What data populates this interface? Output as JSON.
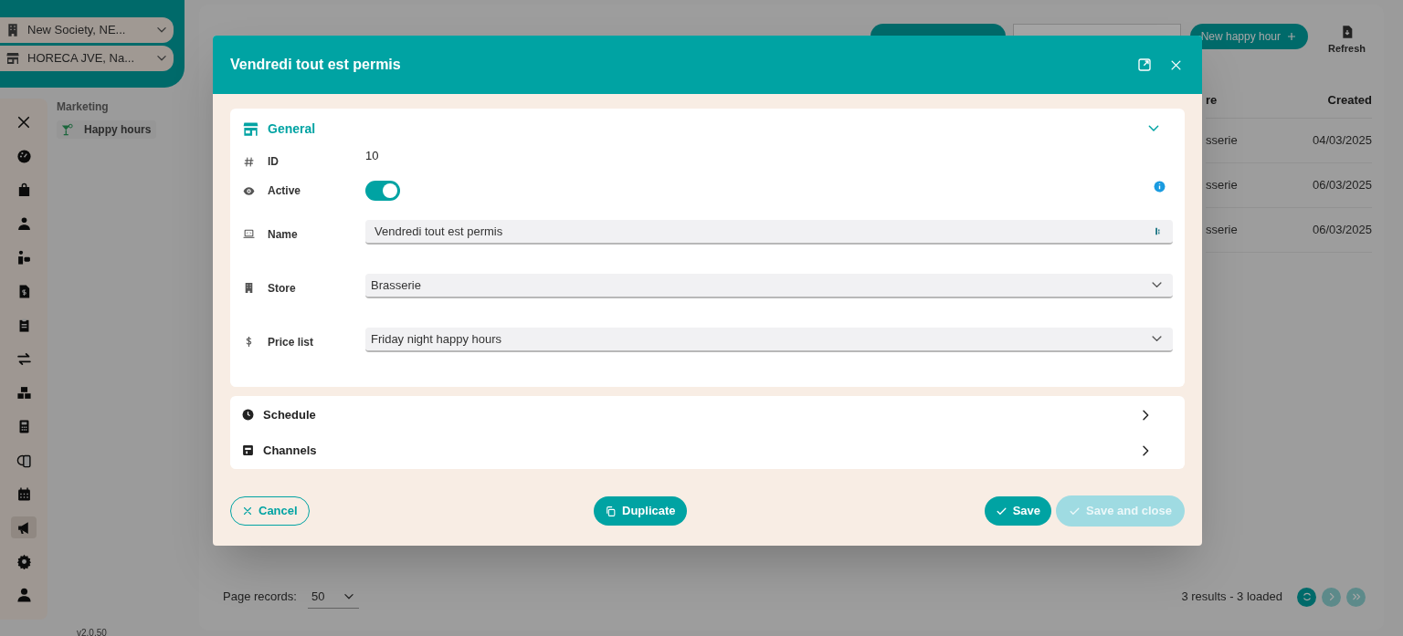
{
  "sidebar": {
    "selectors": [
      {
        "label": "New Society, NE..."
      },
      {
        "label": "HORECA JVE, Na..."
      }
    ],
    "rail": [
      {
        "selected": false
      },
      {
        "selected": false
      },
      {
        "selected": false
      },
      {
        "selected": false
      },
      {
        "selected": false
      },
      {
        "selected": false
      },
      {
        "selected": false
      },
      {
        "selected": false
      },
      {
        "selected": false
      },
      {
        "selected": false
      },
      {
        "selected": false
      },
      {
        "selected": true
      },
      {
        "selected": false
      },
      {
        "selected": false
      }
    ],
    "submenu": {
      "section": "Marketing",
      "items": [
        {
          "label": "Happy hours",
          "selected": true
        }
      ]
    },
    "version": "v2.0.50"
  },
  "toolbar": {
    "new_button": "New happy hour",
    "refresh": "Refresh"
  },
  "table": {
    "columns": [
      "re",
      "Created"
    ],
    "rows": [
      [
        "sserie",
        "04/03/2025"
      ],
      [
        "sserie",
        "06/03/2025"
      ],
      [
        "sserie",
        "06/03/2025"
      ]
    ]
  },
  "footer": {
    "page_records_label": "Page records:",
    "page_records": "50",
    "results": "3 results - 3 loaded"
  },
  "modal": {
    "title": "Vendredi tout est permis",
    "general": {
      "title": "General",
      "expanded": true,
      "fields": [
        {
          "kind": "text",
          "label": "ID",
          "value": "10"
        },
        {
          "kind": "toggle",
          "label": "Active",
          "on": true
        },
        {
          "kind": "input",
          "label": "Name",
          "value": "Vendredi tout est permis"
        },
        {
          "kind": "select",
          "label": "Store",
          "value": "Brasserie"
        },
        {
          "kind": "select",
          "label": "Price list",
          "value": "Friday night happy hours"
        }
      ]
    },
    "sections": [
      {
        "label": "Schedule",
        "expanded": false
      },
      {
        "label": "Channels",
        "expanded": false
      }
    ],
    "buttons": {
      "cancel": "Cancel",
      "duplicate": "Duplicate",
      "save": "Save",
      "save_and_close": {
        "label": "Save and close",
        "disabled": true
      }
    }
  }
}
